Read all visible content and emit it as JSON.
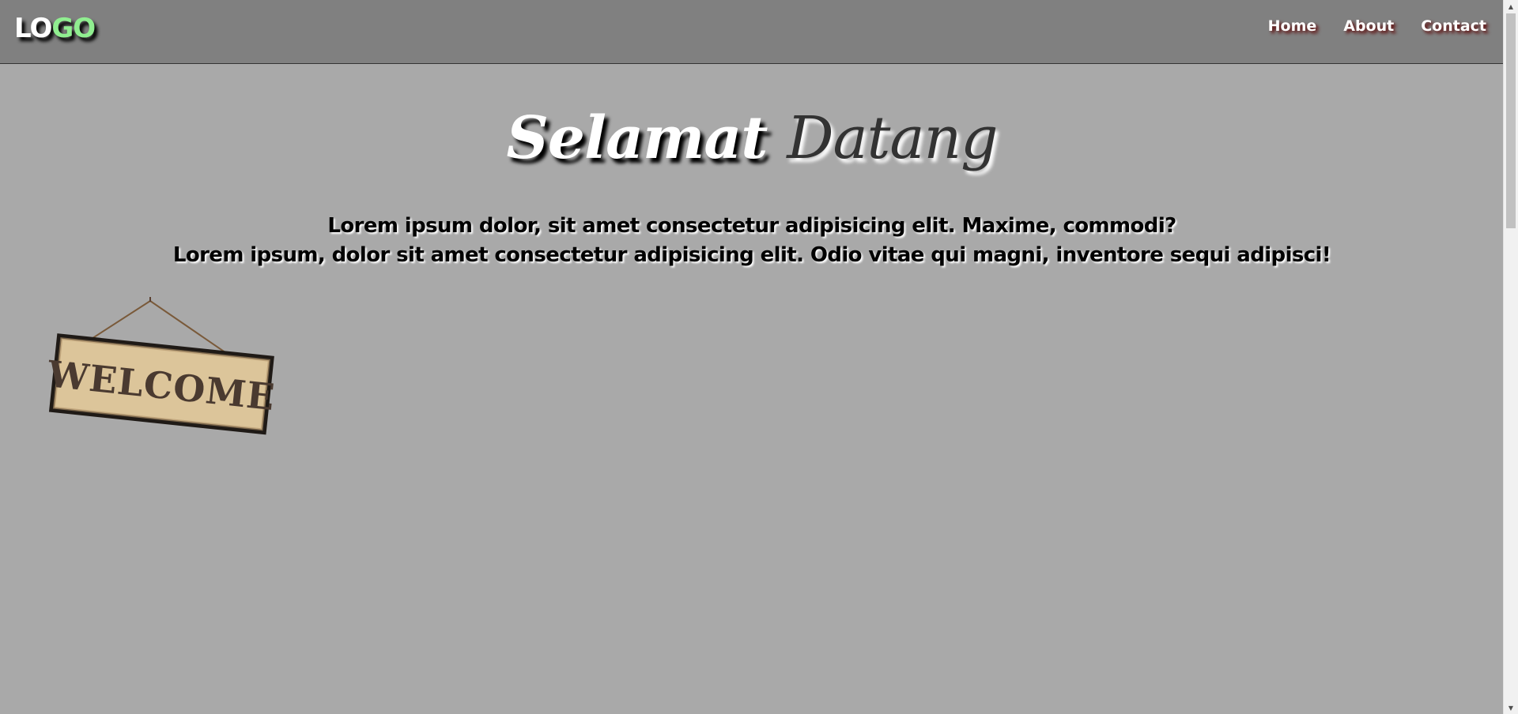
{
  "header": {
    "logo_part1": "LO",
    "logo_part2": "GO",
    "nav": [
      "Home",
      "About",
      "Contact"
    ]
  },
  "hero": {
    "title_word1": "Selamat",
    "title_word2": "Datang",
    "line1": "Lorem ipsum dolor, sit amet consectetur adipisicing elit. Maxime, commodi?",
    "line2": "Lorem ipsum, dolor sit amet consectetur adipisicing elit. Odio vitae qui magni, inventore sequi adipisci!"
  },
  "sign": {
    "text": "WELCOME"
  },
  "colors": {
    "header_bg": "#808080",
    "page_bg": "#a9a9a9",
    "logo_accent": "#90ee90"
  },
  "icons": {
    "scroll_up": "scroll-up-arrow-icon",
    "scroll_down": "scroll-down-arrow-icon"
  }
}
